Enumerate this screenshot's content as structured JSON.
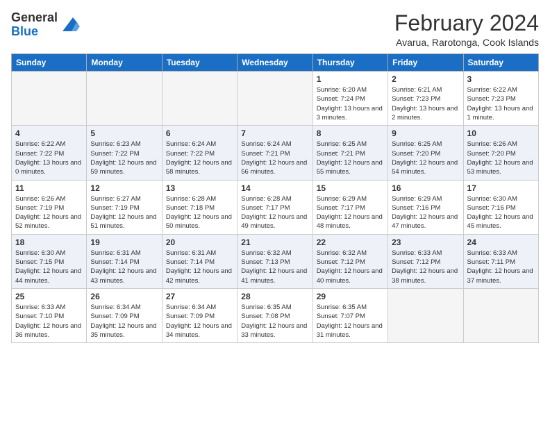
{
  "logo": {
    "general": "General",
    "blue": "Blue"
  },
  "title": "February 2024",
  "subtitle": "Avarua, Rarotonga, Cook Islands",
  "weekdays": [
    "Sunday",
    "Monday",
    "Tuesday",
    "Wednesday",
    "Thursday",
    "Friday",
    "Saturday"
  ],
  "weeks": [
    [
      {
        "day": "",
        "info": ""
      },
      {
        "day": "",
        "info": ""
      },
      {
        "day": "",
        "info": ""
      },
      {
        "day": "",
        "info": ""
      },
      {
        "day": "1",
        "info": "Sunrise: 6:20 AM\nSunset: 7:24 PM\nDaylight: 13 hours and 3 minutes."
      },
      {
        "day": "2",
        "info": "Sunrise: 6:21 AM\nSunset: 7:23 PM\nDaylight: 13 hours and 2 minutes."
      },
      {
        "day": "3",
        "info": "Sunrise: 6:22 AM\nSunset: 7:23 PM\nDaylight: 13 hours and 1 minute."
      }
    ],
    [
      {
        "day": "4",
        "info": "Sunrise: 6:22 AM\nSunset: 7:22 PM\nDaylight: 13 hours and 0 minutes."
      },
      {
        "day": "5",
        "info": "Sunrise: 6:23 AM\nSunset: 7:22 PM\nDaylight: 12 hours and 59 minutes."
      },
      {
        "day": "6",
        "info": "Sunrise: 6:24 AM\nSunset: 7:22 PM\nDaylight: 12 hours and 58 minutes."
      },
      {
        "day": "7",
        "info": "Sunrise: 6:24 AM\nSunset: 7:21 PM\nDaylight: 12 hours and 56 minutes."
      },
      {
        "day": "8",
        "info": "Sunrise: 6:25 AM\nSunset: 7:21 PM\nDaylight: 12 hours and 55 minutes."
      },
      {
        "day": "9",
        "info": "Sunrise: 6:25 AM\nSunset: 7:20 PM\nDaylight: 12 hours and 54 minutes."
      },
      {
        "day": "10",
        "info": "Sunrise: 6:26 AM\nSunset: 7:20 PM\nDaylight: 12 hours and 53 minutes."
      }
    ],
    [
      {
        "day": "11",
        "info": "Sunrise: 6:26 AM\nSunset: 7:19 PM\nDaylight: 12 hours and 52 minutes."
      },
      {
        "day": "12",
        "info": "Sunrise: 6:27 AM\nSunset: 7:19 PM\nDaylight: 12 hours and 51 minutes."
      },
      {
        "day": "13",
        "info": "Sunrise: 6:28 AM\nSunset: 7:18 PM\nDaylight: 12 hours and 50 minutes."
      },
      {
        "day": "14",
        "info": "Sunrise: 6:28 AM\nSunset: 7:17 PM\nDaylight: 12 hours and 49 minutes."
      },
      {
        "day": "15",
        "info": "Sunrise: 6:29 AM\nSunset: 7:17 PM\nDaylight: 12 hours and 48 minutes."
      },
      {
        "day": "16",
        "info": "Sunrise: 6:29 AM\nSunset: 7:16 PM\nDaylight: 12 hours and 47 minutes."
      },
      {
        "day": "17",
        "info": "Sunrise: 6:30 AM\nSunset: 7:16 PM\nDaylight: 12 hours and 45 minutes."
      }
    ],
    [
      {
        "day": "18",
        "info": "Sunrise: 6:30 AM\nSunset: 7:15 PM\nDaylight: 12 hours and 44 minutes."
      },
      {
        "day": "19",
        "info": "Sunrise: 6:31 AM\nSunset: 7:14 PM\nDaylight: 12 hours and 43 minutes."
      },
      {
        "day": "20",
        "info": "Sunrise: 6:31 AM\nSunset: 7:14 PM\nDaylight: 12 hours and 42 minutes."
      },
      {
        "day": "21",
        "info": "Sunrise: 6:32 AM\nSunset: 7:13 PM\nDaylight: 12 hours and 41 minutes."
      },
      {
        "day": "22",
        "info": "Sunrise: 6:32 AM\nSunset: 7:12 PM\nDaylight: 12 hours and 40 minutes."
      },
      {
        "day": "23",
        "info": "Sunrise: 6:33 AM\nSunset: 7:12 PM\nDaylight: 12 hours and 38 minutes."
      },
      {
        "day": "24",
        "info": "Sunrise: 6:33 AM\nSunset: 7:11 PM\nDaylight: 12 hours and 37 minutes."
      }
    ],
    [
      {
        "day": "25",
        "info": "Sunrise: 6:33 AM\nSunset: 7:10 PM\nDaylight: 12 hours and 36 minutes."
      },
      {
        "day": "26",
        "info": "Sunrise: 6:34 AM\nSunset: 7:09 PM\nDaylight: 12 hours and 35 minutes."
      },
      {
        "day": "27",
        "info": "Sunrise: 6:34 AM\nSunset: 7:09 PM\nDaylight: 12 hours and 34 minutes."
      },
      {
        "day": "28",
        "info": "Sunrise: 6:35 AM\nSunset: 7:08 PM\nDaylight: 12 hours and 33 minutes."
      },
      {
        "day": "29",
        "info": "Sunrise: 6:35 AM\nSunset: 7:07 PM\nDaylight: 12 hours and 31 minutes."
      },
      {
        "day": "",
        "info": ""
      },
      {
        "day": "",
        "info": ""
      }
    ]
  ]
}
